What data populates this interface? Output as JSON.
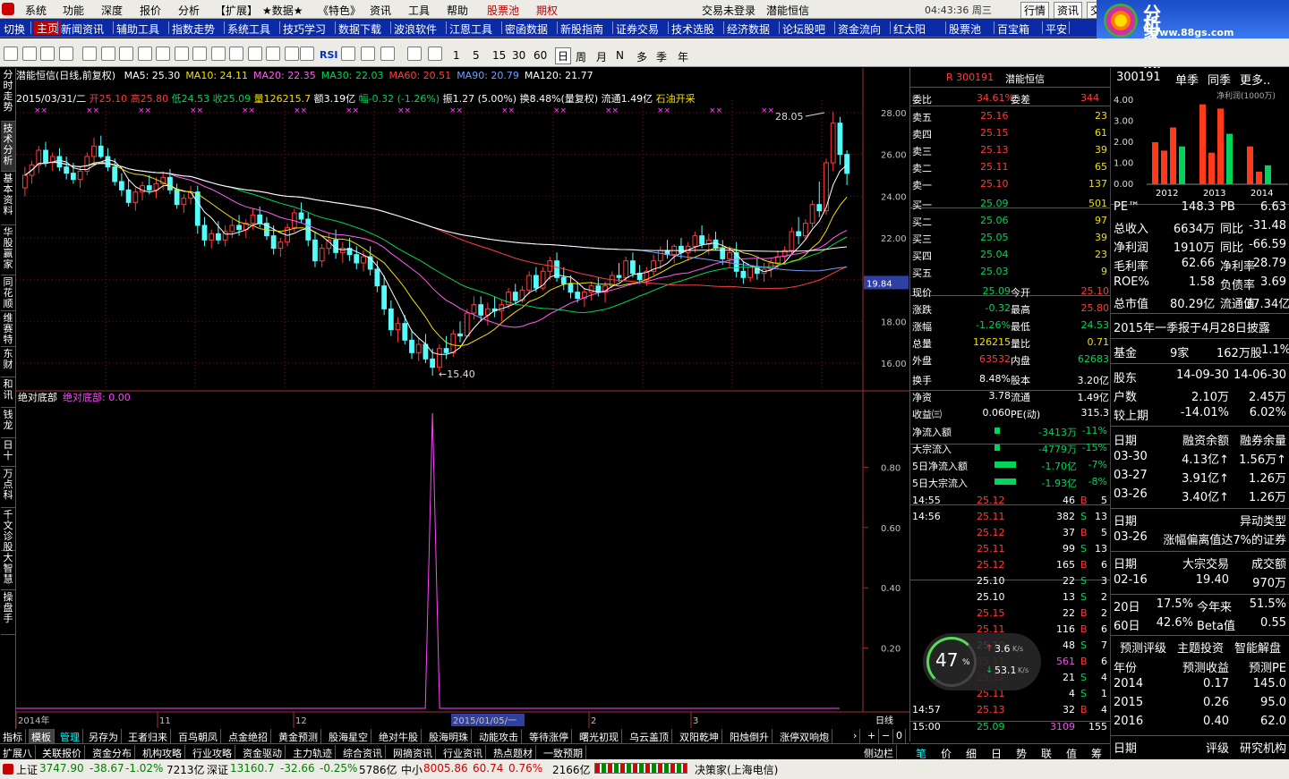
{
  "menu": {
    "items": [
      "系统",
      "功能",
      "深度",
      "报价",
      "分析",
      "【扩展】",
      "★数据★",
      "《特色》",
      "资讯",
      "工具",
      "帮助",
      "股票池",
      "期权"
    ],
    "login": "交易未登录",
    "stock": "潜能恒信",
    "time": "04:43:36 周三",
    "buttons": [
      "行情",
      "资讯",
      "交易"
    ]
  },
  "logo": {
    "title": "分析家公式网",
    "url": "www.88gs.com"
  },
  "ribbon": [
    "切换",
    "主页",
    "新闻资讯",
    "辅助工具",
    "指数走势",
    "系统工具",
    "技巧学习",
    "数据下载",
    "波浪软件",
    "江恩工具",
    "密函数据",
    "新股指南",
    "证券交易",
    "技术选股",
    "经济数据",
    "论坛股吧",
    "资金流向",
    "红太阳",
    "股票池",
    "百宝箱",
    "平安"
  ],
  "toolbar": {
    "labels": [
      "RSI",
      "1",
      "5",
      "15",
      "30",
      "60",
      "日",
      "周",
      "月",
      "N",
      "多",
      "季",
      "年"
    ]
  },
  "lefttabs": [
    "分时走势",
    "技术分析",
    "基本资料",
    "华股赢家",
    "同花顺",
    "维赛特",
    "东财",
    "和讯",
    "钱龙",
    "日十",
    "万点科",
    "千文诊股",
    "大智慧",
    "操盘手"
  ],
  "chart": {
    "header": {
      "title": "潜能恒信(日线,前复权)",
      "ma": [
        {
          "label": "MA5: 25.30",
          "color": "#ffffff"
        },
        {
          "label": "MA10: 24.11",
          "color": "#f0e000"
        },
        {
          "label": "MA20: 22.35",
          "color": "#ff5cf4"
        },
        {
          "label": "MA30: 22.03",
          "color": "#00d45a"
        },
        {
          "label": "MA60: 20.51",
          "color": "#ff4040"
        },
        {
          "label": "MA90: 20.79",
          "color": "#6ca0ff"
        },
        {
          "label": "MA120: 21.77",
          "color": "#ffffff"
        }
      ]
    },
    "infoline": {
      "date": "2015/03/31/二",
      "open": "开25.10",
      "high": "高25.80",
      "low": "低24.53",
      "close": "收25.09",
      "vol": "量126215.7",
      "amount": "额3.19亿",
      "chg": "幅-0.32 (-1.26%)",
      "amp": "振1.27 (5.00%)",
      "turn": "换8.48%(量复权)",
      "float": "流通1.49亿",
      "sector": "石油开采"
    },
    "price_ticks": [
      "28.00",
      "26.00",
      "24.00",
      "22.00",
      "20.00",
      "18.00",
      "16.00"
    ],
    "last_price": "19.84",
    "high_label": "28.05",
    "low_label": "15.40",
    "indicator_title": "绝对底部",
    "indicator_value": "绝对底部: 0.00",
    "ind_ticks": [
      "0.80",
      "0.60",
      "0.40",
      "0.20"
    ],
    "time_labels": [
      "2014年",
      "11",
      "12",
      "2015/01/05/一",
      "2",
      "3"
    ],
    "period": "日线"
  },
  "chart_data": {
    "type": "candlestick",
    "ylim": [
      15,
      29
    ],
    "candles": [
      [
        24.4,
        25.4,
        24.0,
        25.0
      ],
      [
        25.0,
        25.7,
        24.6,
        25.5
      ],
      [
        25.5,
        26.4,
        25.1,
        26.2
      ],
      [
        26.2,
        26.6,
        25.4,
        25.6
      ],
      [
        25.6,
        26.1,
        25.2,
        25.9
      ],
      [
        25.9,
        26.3,
        25.2,
        25.4
      ],
      [
        25.4,
        25.9,
        24.8,
        25.1
      ],
      [
        25.1,
        25.6,
        24.6,
        24.8
      ],
      [
        24.8,
        25.4,
        24.4,
        25.2
      ],
      [
        25.2,
        26.1,
        25.0,
        25.9
      ],
      [
        25.9,
        26.8,
        25.5,
        26.4
      ],
      [
        26.4,
        26.9,
        25.8,
        25.9
      ],
      [
        25.9,
        26.3,
        25.2,
        25.4
      ],
      [
        25.4,
        25.8,
        24.5,
        24.7
      ],
      [
        24.7,
        25.1,
        24.0,
        24.3
      ],
      [
        24.3,
        24.8,
        23.5,
        23.7
      ],
      [
        23.7,
        24.4,
        23.3,
        24.2
      ],
      [
        24.2,
        24.7,
        23.8,
        24.5
      ],
      [
        24.5,
        25.0,
        24.1,
        24.3
      ],
      [
        24.3,
        24.9,
        23.9,
        24.6
      ],
      [
        24.6,
        25.2,
        24.3,
        24.9
      ],
      [
        24.9,
        25.3,
        24.1,
        24.3
      ],
      [
        24.3,
        24.6,
        23.4,
        23.6
      ],
      [
        23.6,
        24.1,
        23.2,
        23.9
      ],
      [
        23.9,
        24.5,
        23.6,
        24.2
      ],
      [
        24.2,
        24.5,
        22.2,
        22.6
      ],
      [
        22.6,
        23.0,
        21.6,
        21.9
      ],
      [
        21.9,
        22.4,
        21.5,
        22.2
      ],
      [
        22.2,
        22.8,
        21.7,
        21.9
      ],
      [
        21.9,
        22.6,
        21.6,
        22.3
      ],
      [
        22.3,
        22.9,
        22.0,
        22.6
      ],
      [
        22.6,
        23.1,
        22.1,
        22.4
      ],
      [
        22.4,
        22.9,
        22.0,
        22.7
      ],
      [
        22.7,
        23.4,
        22.4,
        23.1
      ],
      [
        23.1,
        23.5,
        22.5,
        22.7
      ],
      [
        22.7,
        23.0,
        21.9,
        22.1
      ],
      [
        22.1,
        22.6,
        21.2,
        21.5
      ],
      [
        21.5,
        22.0,
        21.1,
        21.8
      ],
      [
        21.8,
        22.7,
        21.6,
        22.5
      ],
      [
        22.5,
        23.4,
        22.3,
        23.2
      ],
      [
        23.2,
        23.7,
        22.7,
        22.9
      ],
      [
        22.9,
        23.2,
        21.6,
        21.9
      ],
      [
        21.9,
        22.3,
        20.6,
        20.9
      ],
      [
        20.9,
        21.7,
        20.6,
        21.5
      ],
      [
        21.5,
        22.2,
        21.2,
        21.9
      ],
      [
        21.9,
        22.4,
        21.0,
        21.3
      ],
      [
        21.3,
        21.8,
        20.8,
        21.5
      ],
      [
        21.5,
        22.0,
        20.9,
        21.2
      ],
      [
        21.2,
        21.6,
        20.5,
        20.8
      ],
      [
        20.8,
        21.4,
        20.4,
        21.1
      ],
      [
        21.1,
        21.6,
        20.2,
        20.5
      ],
      [
        20.5,
        20.9,
        19.4,
        19.7
      ],
      [
        19.7,
        20.2,
        18.3,
        18.6
      ],
      [
        18.6,
        19.0,
        17.3,
        17.6
      ],
      [
        17.6,
        18.2,
        17.0,
        17.9
      ],
      [
        17.9,
        18.3,
        16.9,
        17.1
      ],
      [
        17.1,
        17.6,
        16.2,
        16.5
      ],
      [
        16.5,
        17.2,
        16.1,
        16.9
      ],
      [
        16.9,
        17.4,
        16.0,
        16.2
      ],
      [
        16.2,
        16.7,
        15.4,
        15.8
      ],
      [
        15.8,
        16.9,
        15.6,
        16.7
      ],
      [
        16.7,
        17.3,
        16.2,
        16.5
      ],
      [
        16.5,
        17.6,
        16.3,
        17.4
      ],
      [
        17.4,
        18.0,
        17.0,
        17.3
      ],
      [
        17.3,
        18.6,
        17.2,
        18.4
      ],
      [
        18.4,
        19.2,
        18.1,
        18.8
      ],
      [
        18.8,
        19.2,
        18.0,
        18.3
      ],
      [
        18.3,
        18.9,
        17.8,
        18.6
      ],
      [
        18.6,
        19.2,
        18.2,
        18.5
      ],
      [
        18.5,
        19.0,
        18.0,
        18.8
      ],
      [
        18.8,
        19.6,
        18.6,
        19.4
      ],
      [
        19.4,
        19.8,
        18.8,
        19.0
      ],
      [
        19.0,
        19.7,
        18.9,
        19.5
      ],
      [
        19.5,
        20.4,
        19.3,
        20.2
      ],
      [
        20.2,
        20.6,
        19.4,
        19.6
      ],
      [
        19.6,
        20.6,
        19.5,
        20.4
      ],
      [
        20.4,
        21.1,
        20.0,
        20.9
      ],
      [
        20.9,
        21.3,
        19.9,
        20.1
      ],
      [
        20.1,
        20.6,
        19.5,
        19.8
      ],
      [
        19.8,
        20.2,
        19.1,
        19.4
      ],
      [
        19.4,
        19.9,
        18.9,
        19.1
      ],
      [
        19.1,
        19.6,
        18.7,
        19.4
      ],
      [
        19.4,
        19.9,
        19.0,
        19.7
      ],
      [
        19.7,
        20.1,
        19.2,
        19.4
      ],
      [
        19.4,
        19.9,
        18.9,
        19.7
      ],
      [
        19.7,
        20.4,
        19.6,
        20.2
      ],
      [
        20.2,
        20.8,
        19.9,
        20.1
      ],
      [
        20.1,
        21.1,
        19.9,
        20.9
      ],
      [
        20.9,
        21.3,
        20.1,
        20.3
      ],
      [
        20.3,
        20.7,
        19.8,
        20.0
      ],
      [
        20.0,
        20.6,
        19.7,
        20.4
      ],
      [
        20.4,
        21.2,
        20.2,
        20.9
      ],
      [
        20.9,
        21.6,
        20.5,
        21.4
      ],
      [
        21.4,
        21.9,
        21.0,
        21.2
      ],
      [
        21.2,
        21.7,
        20.8,
        21.6
      ],
      [
        21.6,
        22.0,
        21.0,
        21.3
      ],
      [
        21.3,
        21.8,
        20.9,
        21.6
      ],
      [
        21.6,
        22.3,
        21.3,
        22.1
      ],
      [
        22.1,
        22.6,
        21.5,
        21.7
      ],
      [
        21.7,
        22.2,
        21.2,
        21.9
      ],
      [
        21.9,
        22.3,
        21.4,
        21.5
      ],
      [
        21.5,
        21.9,
        20.7,
        21.0
      ],
      [
        21.0,
        21.6,
        20.6,
        21.3
      ],
      [
        21.3,
        21.8,
        20.1,
        20.4
      ],
      [
        20.4,
        20.9,
        19.8,
        20.1
      ],
      [
        20.1,
        20.7,
        19.9,
        20.6
      ],
      [
        20.6,
        21.0,
        20.0,
        20.3
      ],
      [
        20.3,
        20.8,
        19.9,
        20.5
      ],
      [
        20.5,
        21.0,
        20.1,
        20.8
      ],
      [
        20.8,
        21.4,
        20.5,
        21.1
      ],
      [
        21.1,
        21.6,
        20.7,
        21.4
      ],
      [
        21.4,
        22.5,
        21.2,
        22.3
      ],
      [
        22.3,
        23.0,
        21.7,
        22.1
      ],
      [
        22.1,
        22.9,
        21.9,
        22.7
      ],
      [
        22.7,
        23.8,
        22.5,
        23.6
      ],
      [
        23.6,
        24.7,
        23.0,
        23.3
      ],
      [
        23.3,
        25.8,
        23.1,
        25.6
      ],
      [
        25.6,
        28.05,
        25.2,
        27.5
      ],
      [
        27.5,
        27.8,
        25.5,
        26.0
      ],
      [
        26.0,
        26.2,
        24.53,
        25.09
      ]
    ],
    "ma": {
      "MA5": {
        "color": "#ffffff",
        "last": 25.3
      },
      "MA10": {
        "color": "#f0e000",
        "last": 24.11
      },
      "MA20": {
        "color": "#ff5cf4",
        "last": 22.35
      },
      "MA30": {
        "color": "#00d45a",
        "last": 22.03
      },
      "MA60": {
        "color": "#ff4040",
        "last": 20.51
      },
      "MA90": {
        "color": "#6ca0ff",
        "last": 20.79
      },
      "MA120": {
        "color": "#ffffff",
        "last": 21.77
      }
    },
    "indicator": {
      "name": "绝对底部",
      "spike_index": 59,
      "spike_value": 0.98,
      "ylim": [
        0,
        1
      ]
    }
  },
  "order": {
    "code": "300191",
    "name": "潜能恒信",
    "weibi_label": "委比",
    "weibi": "34.61%",
    "weicha_label": "委差",
    "weicha": "344",
    "sell": [
      {
        "label": "卖五",
        "price": "25.16",
        "vol": "23"
      },
      {
        "label": "卖四",
        "price": "25.15",
        "vol": "61"
      },
      {
        "label": "卖三",
        "price": "25.13",
        "vol": "39"
      },
      {
        "label": "卖二",
        "price": "25.11",
        "vol": "65"
      },
      {
        "label": "卖一",
        "price": "25.10",
        "vol": "137"
      }
    ],
    "buy": [
      {
        "label": "买一",
        "price": "25.09",
        "vol": "501"
      },
      {
        "label": "买二",
        "price": "25.06",
        "vol": "97"
      },
      {
        "label": "买三",
        "price": "25.05",
        "vol": "39"
      },
      {
        "label": "买四",
        "price": "25.04",
        "vol": "23"
      },
      {
        "label": "买五",
        "price": "25.03",
        "vol": "9"
      }
    ],
    "quote": [
      [
        "现价",
        "25.09",
        "今开",
        "25.10"
      ],
      [
        "涨跌",
        "-0.32",
        "最高",
        "25.80"
      ],
      [
        "涨幅",
        "-1.26%",
        "最低",
        "24.53"
      ],
      [
        "总量",
        "126215",
        "量比",
        "0.71"
      ],
      [
        "外盘",
        "63532",
        "内盘",
        "62683"
      ]
    ],
    "stats": [
      [
        "换手",
        "8.48%",
        "股本",
        "3.20亿"
      ],
      [
        "净资",
        "3.78",
        "流通",
        "1.49亿"
      ],
      [
        "收益㈢",
        "0.060",
        "PE(动)",
        "315.3"
      ]
    ],
    "flow": [
      [
        "净流入额",
        "-3413万",
        "-11%"
      ],
      [
        "大宗流入",
        "-4779万",
        "-15%"
      ],
      [
        "5日净流入额",
        "-1.70亿",
        "-7%"
      ],
      [
        "5日大宗流入",
        "-1.93亿",
        "-8%"
      ]
    ],
    "ticks": [
      [
        "14:55",
        "25.12",
        "46",
        "B",
        "5"
      ],
      [
        "14:56",
        "25.11",
        "382",
        "S",
        "13"
      ],
      [
        "",
        "25.12",
        "37",
        "B",
        "5"
      ],
      [
        "",
        "25.11",
        "99",
        "S",
        "13"
      ],
      [
        "",
        "25.12",
        "165",
        "B",
        "6"
      ],
      [
        "",
        "25.10",
        "22",
        "S",
        "3"
      ],
      [
        "",
        "25.10",
        "13",
        "S",
        "2"
      ],
      [
        "",
        "25.15",
        "22",
        "B",
        "2"
      ],
      [
        "",
        "25.11",
        "116",
        "B",
        "6"
      ],
      [
        "",
        "25.10",
        "48",
        "S",
        "7"
      ],
      [
        "",
        "25.11",
        "561",
        "B",
        "6"
      ],
      [
        "",
        "25.11",
        "21",
        "S",
        "4"
      ],
      [
        "",
        "25.11",
        "4",
        "S",
        "1"
      ],
      [
        "14:57",
        "25.13",
        "32",
        "B",
        "4"
      ],
      [
        "15:00",
        "25.09",
        "3109",
        "",
        "155"
      ]
    ],
    "gauge": {
      "pct": "47",
      "up": "3.6",
      "down": "53.1",
      "unit": "K/s"
    },
    "tabs": [
      "笔",
      "价",
      "细",
      "日",
      "势",
      "联",
      "值",
      "筹"
    ]
  },
  "rightinfo": {
    "code": "300191",
    "tabs": [
      "单季",
      "同季",
      "更多.."
    ],
    "mini_chart": {
      "type": "bar",
      "title": "净利润(1000万)",
      "yticks": [
        "4.00",
        "3.00",
        "2.00",
        "1.00",
        "0.00"
      ],
      "years": [
        "2012",
        "2013",
        "2014"
      ],
      "values": [
        [
          2.0,
          1.6,
          2.7,
          1.8
        ],
        [
          3.8,
          1.5,
          3.6,
          2.4
        ],
        [
          1.8,
          0.6,
          0.9,
          0.0
        ]
      ],
      "colors": [
        "#ff3a1a",
        "#ff3a1a",
        "#ff3a1a",
        "#00d45a"
      ]
    },
    "rows": [
      [
        "PE™",
        "148.3",
        "PB",
        "6.63"
      ],
      [
        "总收入",
        "6634万",
        "同比",
        "-31.48"
      ],
      [
        "净利润",
        "1910万",
        "同比",
        "-66.59"
      ],
      [
        "毛利率",
        "62.66",
        "净利率",
        "28.79"
      ],
      [
        "ROE%",
        "1.58",
        "负债率",
        "3.69"
      ],
      [
        "总市值",
        "80.29亿",
        "流通值",
        "37.34亿"
      ]
    ],
    "notice": "2015年一季报于4月28日披露",
    "fund": [
      "基金",
      "9家",
      "162万股",
      "1.1%"
    ],
    "holders": [
      [
        "股东",
        "14-09-30",
        "14-06-30"
      ],
      [
        "户数",
        "2.10万",
        "2.45万"
      ],
      [
        "较上期",
        "-14.01%",
        "6.02%"
      ]
    ],
    "margin": [
      [
        "日期",
        "融资余额",
        "融券余量"
      ],
      [
        "03-30",
        "4.13亿↑",
        "1.56万↑"
      ],
      [
        "03-27",
        "3.91亿↑",
        "1.26万"
      ],
      [
        "03-26",
        "3.40亿↑",
        "1.26万"
      ]
    ],
    "unusual": [
      [
        "日期",
        "异动类型"
      ],
      [
        "03-26",
        "涨幅偏离值达7%的证券"
      ]
    ],
    "block": [
      [
        "日期",
        "大宗交易",
        "成交额"
      ],
      [
        "02-16",
        "19.40",
        "970万"
      ]
    ],
    "beta": [
      [
        "20日",
        "17.5%",
        "今年来",
        "51.5%"
      ],
      [
        "60日",
        "42.6%",
        "Beta值",
        "0.55"
      ]
    ],
    "forecast_tabs": [
      "预测评级",
      "主题投资",
      "智能解盘"
    ],
    "forecast": [
      [
        "年份",
        "预测收益",
        "预测PE"
      ],
      [
        "2014",
        "0.17",
        "145.0"
      ],
      [
        "2015",
        "0.26",
        "95.0"
      ],
      [
        "2016",
        "0.40",
        "62.0"
      ]
    ],
    "rating": [
      "日期",
      "评级",
      "研究机构"
    ]
  },
  "bottom_tabs": [
    "指标",
    "模板",
    "管理",
    "另存为",
    "王者归来",
    "百鸟朝凤",
    "点金绝招",
    "黄金预测",
    "股海星空",
    "绝对牛股",
    "股海明珠",
    "动能攻击",
    "等待涨停",
    "曙光初现",
    "乌云盖顶",
    "双阳乾坤",
    "阳烛倒升",
    "涨停双响炮"
  ],
  "bottom_tabs2": [
    "扩展八",
    "关联报价",
    "资金分布",
    "机构攻略",
    "行业攻略",
    "资金驱动",
    "主力轨迹",
    "综合资讯",
    "网摘资讯",
    "行业资讯",
    "热点题材",
    "一致预期"
  ],
  "side_btn": "侧边栏",
  "status": {
    "sh_label": "上证",
    "sh": "3747.90",
    "sh_chg": "-38.67",
    "sh_pct": "-1.02%",
    "sh_amt": "7213亿",
    "sz_label": "深证",
    "sz": "13160.7",
    "sz_chg": "-32.66",
    "sz_pct": "-0.25%",
    "sz_amt": "5786亿",
    "zx_label": "中小",
    "zx": "8005.86",
    "zx_chg": "60.74",
    "zx_pct": "0.76%",
    "zx_amt": "2166亿",
    "source": "决策家(上海电信)"
  }
}
